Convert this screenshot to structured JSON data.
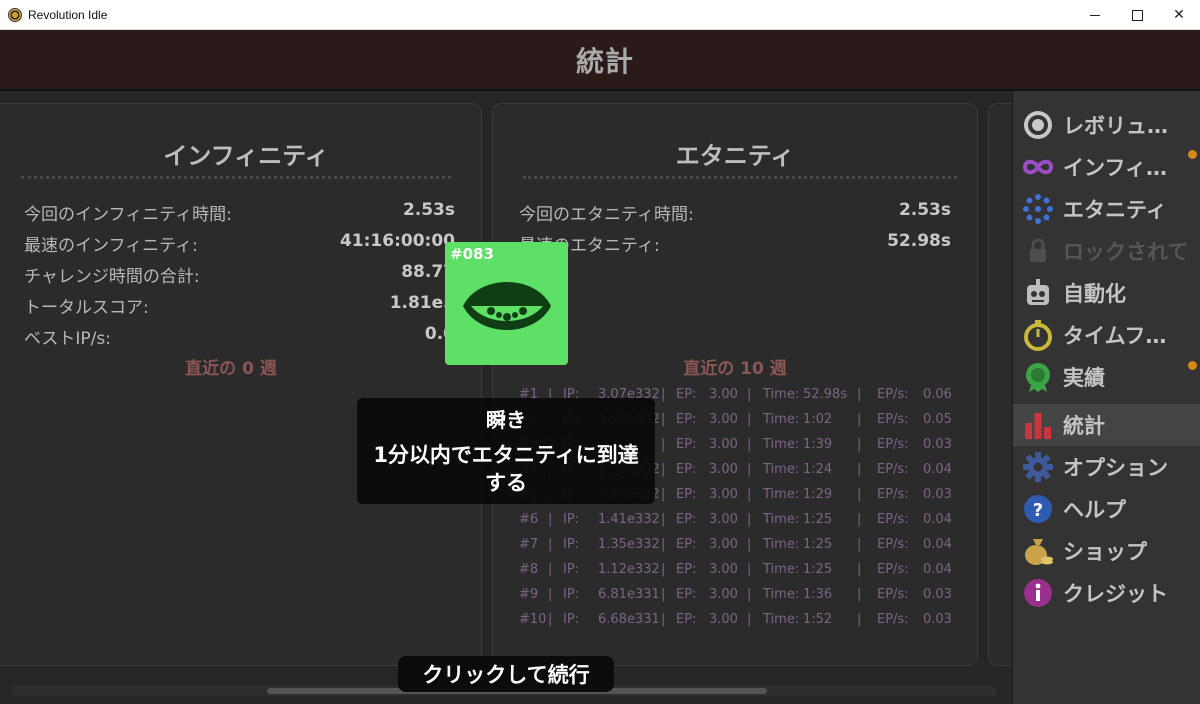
{
  "window": {
    "title": "Revolution Idle",
    "minimize": "",
    "maximize": "",
    "close": "✕"
  },
  "header": {
    "title": "統計"
  },
  "infinity": {
    "title": "インフィニティ",
    "stats": [
      {
        "label": "今回のインフィニティ時間:",
        "value": "2.53s"
      },
      {
        "label": "最速のインフィニティ:",
        "value": "41:16:00:00"
      },
      {
        "label": "チャレンジ時間の合計:",
        "value": "88.77"
      },
      {
        "label": "トータルスコア:",
        "value": "1.81e5"
      },
      {
        "label": "ベストIP/s:",
        "value": "0.0"
      }
    ],
    "recent": "直近の 0 週"
  },
  "eternity": {
    "title": "エタニティ",
    "stats": [
      {
        "label": "今回のエタニティ時間:",
        "value": "2.53s"
      },
      {
        "label": "最速のエタニティ:",
        "value": "52.98s"
      }
    ],
    "recent": "直近の 10 週",
    "log": [
      {
        "n": "#1",
        "ip": "3.07e332",
        "ep": "3.00",
        "time": "52.98s",
        "eps": "0.06"
      },
      {
        "n": "#2",
        "ip": "5.96e332",
        "ep": "3.00",
        "time": "1:02",
        "eps": "0.05"
      },
      {
        "n": "#3",
        "ip": "",
        "ep": "3.00",
        "time": "1:39",
        "eps": "0.03"
      },
      {
        "n": "#4",
        "ip": "1.52e332",
        "ep": "3.00",
        "time": "1:24",
        "eps": "0.04"
      },
      {
        "n": "#5",
        "ip": "1.50e332",
        "ep": "3.00",
        "time": "1:29",
        "eps": "0.03"
      },
      {
        "n": "#6",
        "ip": "1.41e332",
        "ep": "3.00",
        "time": "1:25",
        "eps": "0.04"
      },
      {
        "n": "#7",
        "ip": "1.35e332",
        "ep": "3.00",
        "time": "1:25",
        "eps": "0.04"
      },
      {
        "n": "#8",
        "ip": "1.12e332",
        "ep": "3.00",
        "time": "1:25",
        "eps": "0.04"
      },
      {
        "n": "#9",
        "ip": "6.81e331",
        "ep": "3.00",
        "time": "1:36",
        "eps": "0.03"
      },
      {
        "n": "#10",
        "ip": "6.68e331",
        "ep": "3.00",
        "time": "1:52",
        "eps": "0.03"
      }
    ],
    "labels": {
      "ip": "IP:",
      "ep": "EP:",
      "time": "Time:",
      "eps": "EP/s:",
      "sep": "|"
    }
  },
  "sidebar": {
    "items": [
      {
        "label": "レボリュ…",
        "icon": "target-icon"
      },
      {
        "label": "インフィ…",
        "icon": "infinity-icon",
        "notify": true
      },
      {
        "label": "エタニティ",
        "icon": "eternity-dots-icon"
      },
      {
        "label": "ロックされて",
        "icon": "lock-icon",
        "locked": true
      },
      {
        "label": "自動化",
        "icon": "robot-icon"
      },
      {
        "label": "タイムフ…",
        "icon": "stopwatch-icon"
      },
      {
        "label": "実績",
        "icon": "medal-icon",
        "notify": true
      },
      {
        "label": "統計",
        "icon": "bar-chart-icon",
        "active": true
      },
      {
        "label": "オプション",
        "icon": "gear-icon"
      },
      {
        "label": "ヘルプ",
        "icon": "question-icon"
      },
      {
        "label": "ショップ",
        "icon": "money-bag-icon"
      },
      {
        "label": "クレジット",
        "icon": "info-icon"
      }
    ]
  },
  "popup": {
    "number": "#083",
    "title": "瞬き",
    "description": "1分以内でエタニティに到達する",
    "continue": "クリックして続行",
    "card_color": "#5de065"
  }
}
